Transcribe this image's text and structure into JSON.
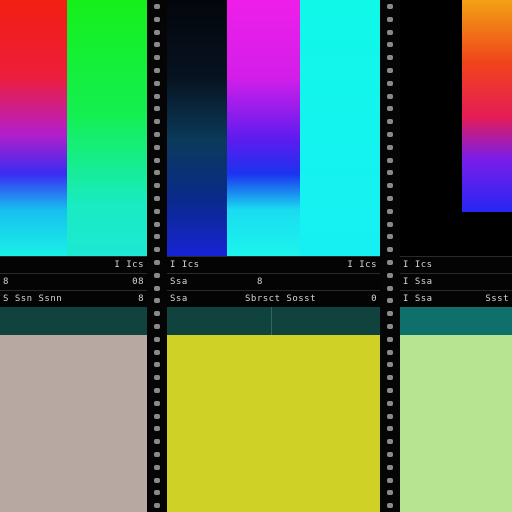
{
  "panels": [
    {
      "name": "left",
      "info_rows": [
        {
          "left": "",
          "right": "I Ics"
        },
        {
          "left": "8",
          "right": "08"
        },
        {
          "left": "S Ssn Ssnn",
          "right": "8"
        }
      ],
      "swatch_color": "#b7a8a2"
    },
    {
      "name": "middle",
      "info_rows": [
        {
          "left": "I Ics",
          "right": "I Ics"
        },
        {
          "left": "Ssa",
          "right": "8"
        },
        {
          "left": "Ssa",
          "right": "Sbrsct Sosst",
          "extra": "0"
        }
      ],
      "swatch_color": "#cfd126"
    },
    {
      "name": "right",
      "info_rows": [
        {
          "left": "I Ics",
          "right": ""
        },
        {
          "left": "I Ssa",
          "right": ""
        },
        {
          "left": "I Ssa",
          "right": "Ssst"
        }
      ],
      "swatch_color": "#b7e491"
    }
  ],
  "colors": {
    "background": "#000000",
    "teal_band": "#10433d",
    "sprocket_hole": "#8a8a8a"
  }
}
